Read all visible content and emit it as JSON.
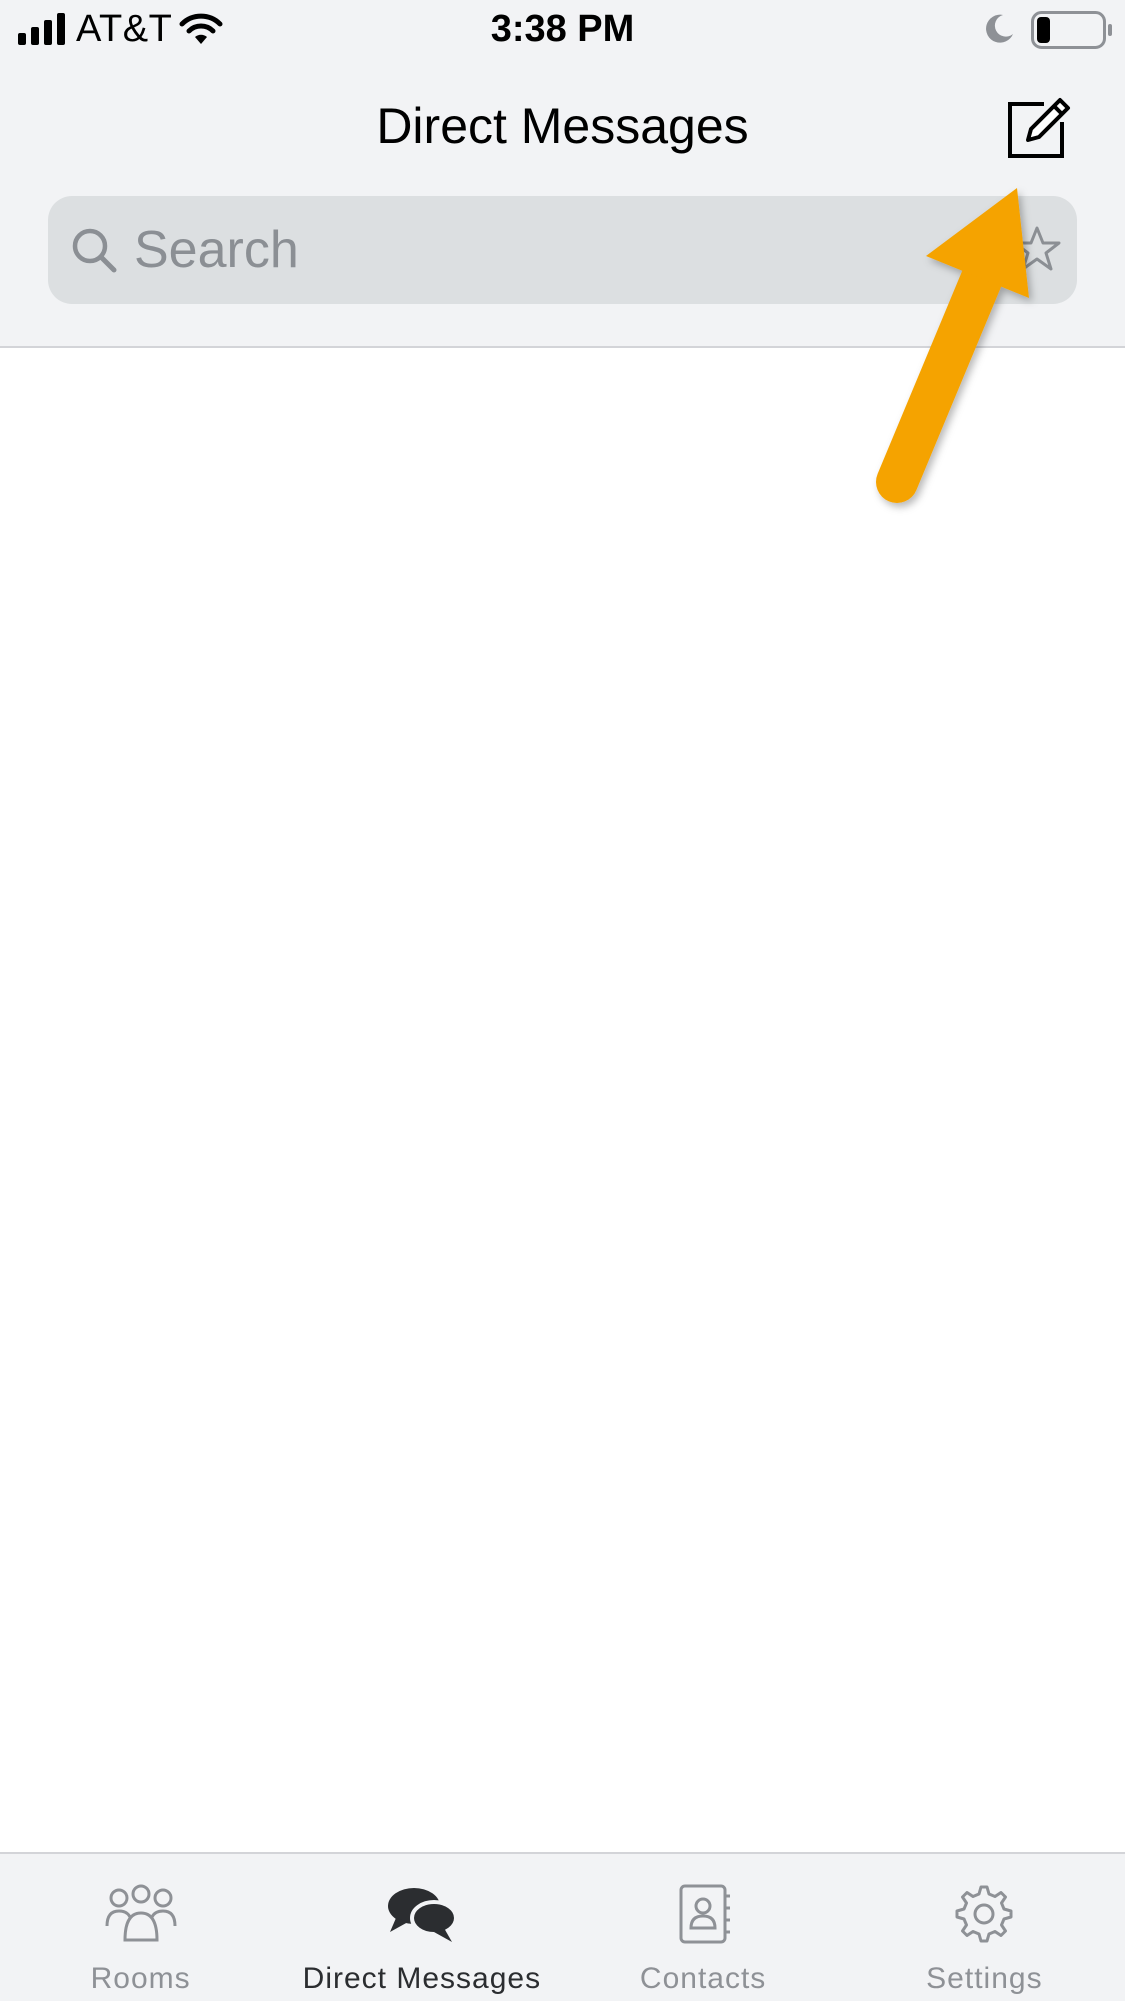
{
  "status_bar": {
    "carrier": "AT&T",
    "time": "3:38 PM",
    "battery_level": 0.2,
    "icons": [
      "signal-icon",
      "wifi-icon",
      "moon-icon",
      "battery-icon"
    ]
  },
  "header": {
    "title": "Direct Messages",
    "compose_icon": "compose-icon"
  },
  "search": {
    "placeholder": "Search",
    "value": "",
    "icons": [
      "search-icon",
      "star-icon"
    ]
  },
  "tabs": [
    {
      "label": "Rooms",
      "icon": "rooms-icon",
      "active": false
    },
    {
      "label": "Direct Messages",
      "icon": "chat-bubbles-icon",
      "active": true
    },
    {
      "label": "Contacts",
      "icon": "contacts-icon",
      "active": false
    },
    {
      "label": "Settings",
      "icon": "gear-icon",
      "active": false
    }
  ],
  "colors": {
    "bar_background": "#f2f3f5",
    "search_background": "#dcdfe1",
    "annotation_arrow": "#f5a300",
    "tab_active": "#2b2d30",
    "tab_inactive": "#8e9196"
  }
}
